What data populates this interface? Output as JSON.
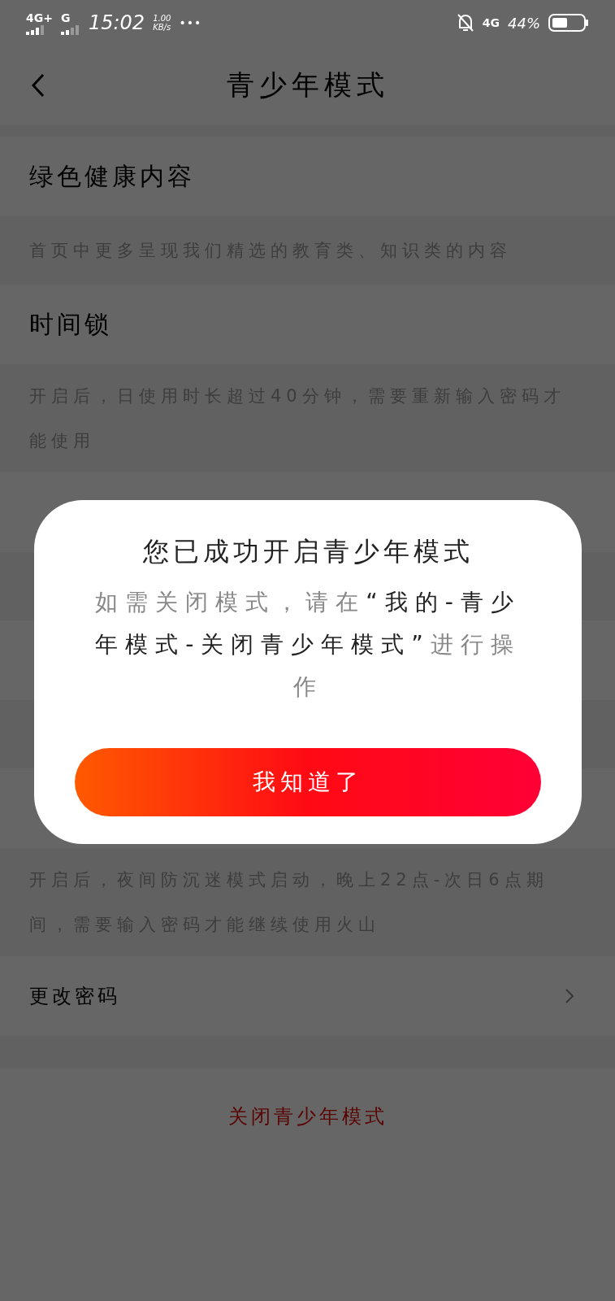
{
  "status_bar": {
    "network_1": "4G+",
    "network_2": "G",
    "time": "15:02",
    "speed": "1.00",
    "speed_unit": "KB/s",
    "more": "•••",
    "network_3": "4G",
    "battery": "44%"
  },
  "header": {
    "title": "青少年模式"
  },
  "sections": [
    {
      "kind": "row",
      "title": "绿色健康内容"
    },
    {
      "kind": "desc",
      "text": "首页中更多呈现我们精选的教育类、知识类的内容"
    },
    {
      "kind": "row",
      "title": "时间锁"
    },
    {
      "kind": "desc",
      "text": "开启后，日使用时长超过40分钟，需要重新输入密码才能使用"
    },
    {
      "kind": "row"
    },
    {
      "kind": "desc"
    },
    {
      "kind": "row"
    },
    {
      "kind": "desc"
    },
    {
      "kind": "row"
    },
    {
      "kind": "desc",
      "text": "开启后，夜间防沉迷模式启动，晚上22点-次日6点期间，需要输入密码才能继续使用火山"
    },
    {
      "kind": "link",
      "title": "更改密码"
    },
    {
      "kind": "gap"
    },
    {
      "kind": "action",
      "title": "关闭青少年模式"
    }
  ],
  "dialog": {
    "title": "您已成功开启青少年模式",
    "message": [
      {
        "text": "如需关闭模式，请在",
        "emphasis": false
      },
      {
        "text": "“我的-青少年模式-关闭青少年模式”",
        "emphasis": true
      },
      {
        "text": "进行操作",
        "emphasis": false
      }
    ],
    "button": "我知道了"
  }
}
